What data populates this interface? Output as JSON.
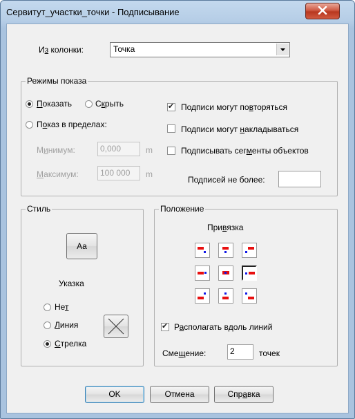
{
  "window": {
    "title": "Сервитут_участки_точки - Подписывание",
    "close_icon": "close-x-icon"
  },
  "column": {
    "label_pre": "И",
    "label_u": "з",
    "label_post": " колонки:",
    "value": "Точка"
  },
  "display_modes": {
    "title": "Режимы показа",
    "show": {
      "u": "П",
      "rest": "оказать",
      "checked": true
    },
    "hide": {
      "pre": "С",
      "u": "к",
      "rest": "рыть",
      "checked": false
    },
    "range": {
      "pre": "П",
      "u": "о",
      "rest": "каз в пределах:",
      "checked": false
    },
    "min": {
      "pre": "М",
      "u": "и",
      "rest": "нимум:",
      "value": "0,000",
      "unit": "m"
    },
    "max": {
      "u": "М",
      "rest": "аксимум:",
      "value": "100 000",
      "unit": "m"
    },
    "repeat": {
      "pre": "Подписи могут по",
      "u": "в",
      "rest": "торяться",
      "checked": true
    },
    "overlap": {
      "pre": "Подписи могут ",
      "u": "н",
      "rest": "акладываться",
      "checked": false
    },
    "segments": {
      "pre": "Подписывать сег",
      "u": "м",
      "rest": "енты объектов",
      "checked": false
    },
    "max_count": {
      "pre": "По",
      "u": "д",
      "rest": "писей не более:",
      "value": ""
    }
  },
  "style": {
    "title": "Стиль",
    "font_button": "Aa",
    "pointer_title": "Указка",
    "none": {
      "pre": "Не",
      "u": "т",
      "rest": "",
      "checked": false
    },
    "line": {
      "pre": "",
      "u": "Л",
      "rest": "иния",
      "checked": false
    },
    "arrow": {
      "pre": "",
      "u": "С",
      "rest": "трелка",
      "checked": true
    },
    "pointer_icon": "cross-line-icon"
  },
  "position": {
    "title": "Положение",
    "anchor_title": {
      "pre": "При",
      "u": "в",
      "rest": "язка"
    },
    "anchors": [
      "top-left",
      "top-center",
      "top-right",
      "middle-left",
      "center",
      "middle-right",
      "bottom-left",
      "bottom-center",
      "bottom-right"
    ],
    "selected_anchor": "middle-right",
    "along_lines": {
      "pre": "Р",
      "u": "а",
      "rest": "сполагать вдоль линий",
      "checked": true
    },
    "offset": {
      "pre": "Сме",
      "u": "щ",
      "rest": "ение:",
      "value": "2",
      "unit": "точек"
    }
  },
  "buttons": {
    "ok": "OK",
    "cancel": "Отмена",
    "help_pre": "Спр",
    "help_u": "а",
    "help_rest": "вка"
  },
  "colors": {
    "marker_red": "#e81010",
    "marker_blue": "#1018e8"
  }
}
